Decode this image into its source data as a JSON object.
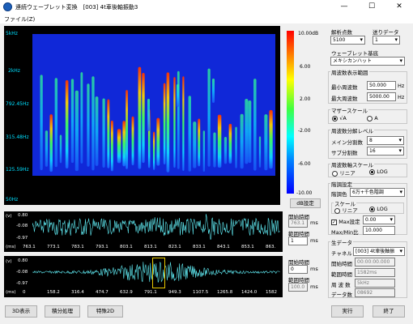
{
  "window": {
    "title": "連続ウェーブレット変換　[003] 4t車後軸振動3",
    "minimize": "—",
    "maximize": "☐",
    "close": "✕"
  },
  "menu": {
    "file": "ファイル(Z)"
  },
  "spectrogram": {
    "y_labels": [
      "5kHz",
      "2kHz",
      "792.45Hz",
      "315.48Hz",
      "125.59Hz",
      "50Hz"
    ],
    "colorbar_labels": [
      "10.00dB",
      "6.00",
      "2.00",
      "-2.00",
      "-6.00",
      "-10.00"
    ],
    "db_button": "dB設定"
  },
  "wave1": {
    "unit_v": "(v)",
    "unit_ms": "(ms)",
    "y_labels": [
      "0.80",
      "-0.08",
      "-0.97"
    ],
    "x_labels": [
      "763.1",
      "773.1",
      "783.1",
      "793.1",
      "803.1",
      "813.1",
      "823.1",
      "833.1",
      "843.1",
      "853.1",
      "863."
    ],
    "start_label": "開始時間",
    "start_value": "763.1",
    "start_unit": "ms",
    "range_label": "範囲時間",
    "range_value": "1",
    "range_unit": "ms"
  },
  "wave2": {
    "unit_v": "(v)",
    "unit_ms": "(ms)",
    "y_labels": [
      "0.80",
      "-0.08",
      "-0.97"
    ],
    "x_labels": [
      "0",
      "158.2",
      "316.4",
      "474.7",
      "632.9",
      "791.1",
      "949.3",
      "1107.5",
      "1265.8",
      "1424.0",
      "1582"
    ],
    "start_label": "開始時間",
    "start_value": "0",
    "start_unit": "ms",
    "range_label": "範囲時間",
    "range_value": "100.0",
    "range_unit": "ms"
  },
  "settings": {
    "analysis_points_label": "解析点数",
    "analysis_points": "5100",
    "feed_label": "送りデータ",
    "feed": "1",
    "wavelet_label": "ウェーブレット基底",
    "wavelet": "メキシカンハット",
    "freq_range_label": "周波数表示範囲",
    "min_freq_label": "最小周波数",
    "min_freq": "50.000",
    "min_unit": "Hz",
    "max_freq_label": "最大周波数",
    "max_freq": "5000.00",
    "max_unit": "Hz",
    "mother_label": "マザースケール",
    "mother_a": "√A",
    "mother_b": "A",
    "res_label": "周波数分解レベル",
    "main_div_label": "メイン分割数",
    "main_div": "8",
    "sub_div_label": "サブ分割数",
    "sub_div": "16",
    "freq_scale_label": "周波数軸スケール",
    "linear": "リニア",
    "log": "LOG",
    "tone_label": "階調設定",
    "tone_color_label": "階調色",
    "tone_color": "6万+千色階調",
    "scale_label": "スケール",
    "scale_linear": "リニア",
    "scale_log": "LOG",
    "max_label": "Max設定",
    "max_value": "0.00",
    "maxmin_label": "Max/Min比",
    "maxmin_value": "10.000"
  },
  "raw": {
    "title": "生データ",
    "channel_label": "チャネル",
    "channel": "[003] 4t車後軸振",
    "start_label": "開始時間",
    "start": "00:00:00.000",
    "range_label": "範囲時間",
    "range": "1582ms",
    "freq_label": "周 波 数",
    "freq": "5kHz",
    "count_label": "データ数",
    "count": "08692"
  },
  "buttons": {
    "display3d": "3D表示",
    "integrate": "積分処理",
    "special2d": "特殊2D",
    "run": "実行",
    "close": "終了"
  },
  "colors": {
    "plot_bg": "#000000",
    "trace": "#5fe8f0",
    "spec_bg": "#1028d8",
    "selection": "#e8c800"
  }
}
